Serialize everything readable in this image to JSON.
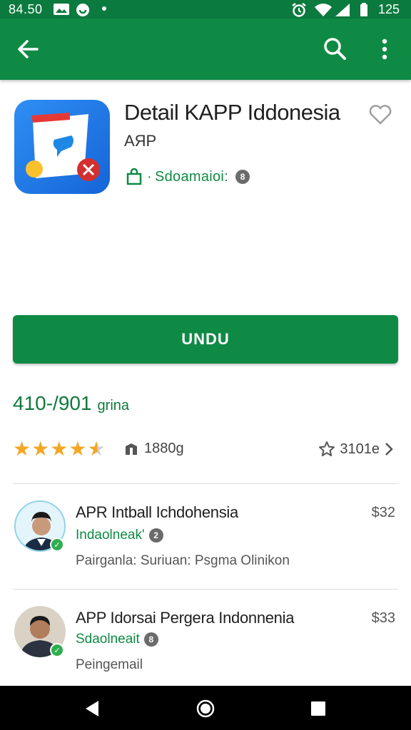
{
  "status_bar": {
    "time": "84.50",
    "clock_right": "125"
  },
  "app_bar": {
    "back_icon": "arrow-left-icon",
    "search_icon": "search-icon",
    "more_icon": "more-vert-icon"
  },
  "app": {
    "title": "Detail KAPP Iddonesia",
    "subtitle": "AЯP",
    "developer_label": "Sdoamaioi:",
    "developer_badge": "8",
    "icon": "app-icon"
  },
  "install_button": {
    "label": "UNDU"
  },
  "stats": {
    "downloads_value": "410-/901",
    "downloads_unit": "grina",
    "rating": 4.5,
    "size": "1880g",
    "right_label": "3101e"
  },
  "list": [
    {
      "title": "APR Intball Ichdohensia",
      "price": "$32",
      "developer": "Indaolneak'",
      "developer_badge": "2",
      "description": "Pairganla: Suriuan: Psgma Olinikon"
    },
    {
      "title": "APP Idorsai Pergera Indonnenia",
      "price": "$33",
      "developer": "Sdaolneait",
      "developer_badge": "8",
      "description": "Peingemail"
    }
  ],
  "colors": {
    "brand_green": "#0f8a45",
    "status_green": "#0b7a3e",
    "star": "#f5a623"
  }
}
